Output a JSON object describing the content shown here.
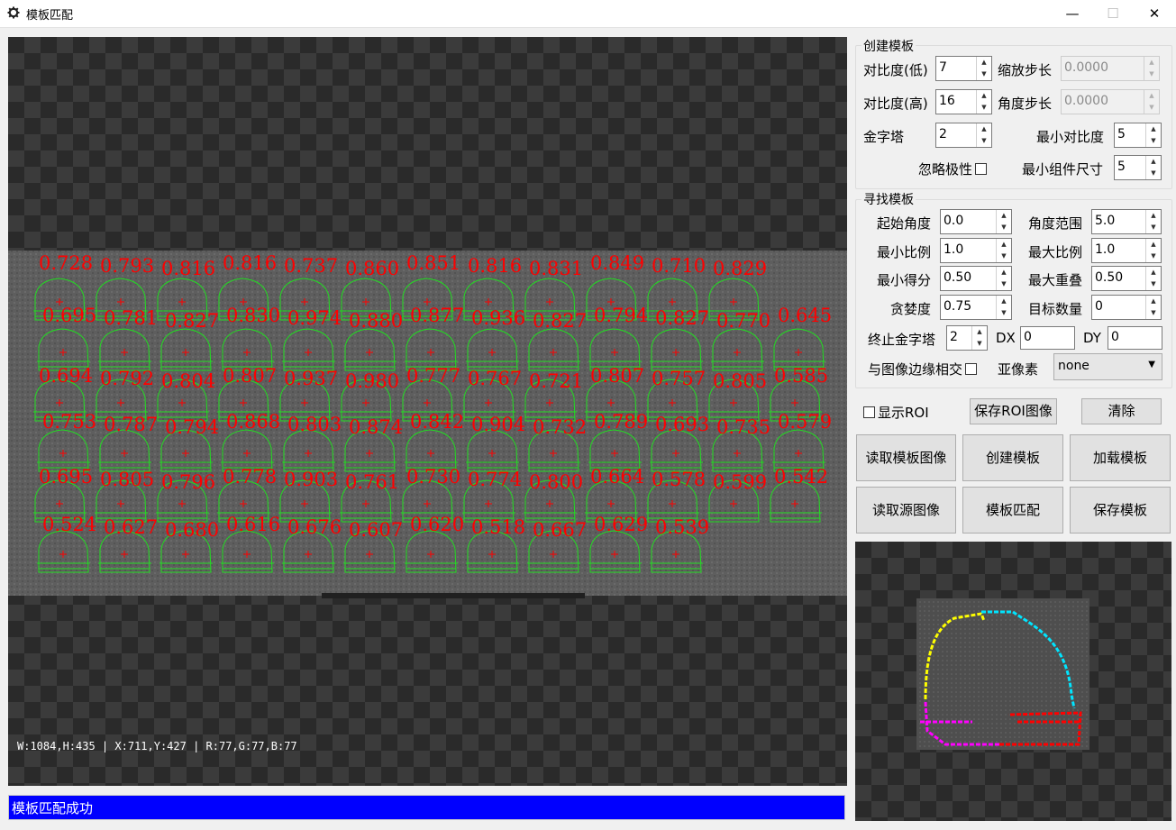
{
  "window": {
    "title": "模板匹配",
    "minimize": "—",
    "maximize": "☐",
    "close": "✕"
  },
  "canvas": {
    "status_text": "W:1084,H:435 | X:711,Y:427 | R:77,G:77,B:77",
    "score_color": "#ff0000",
    "contour_color": "#22dd22",
    "scores": [
      [
        "0.728",
        "0.793",
        "0.816",
        "0.816",
        "0.737",
        "0.860",
        "0.851",
        "0.816",
        "0.831",
        "0.849",
        "0.710",
        "0.829"
      ],
      [
        "0.695",
        "0.781",
        "0.827",
        "0.830",
        "0.974",
        "0.880",
        "0.877",
        "0.936",
        "0.827",
        "0.794",
        "0.827",
        "0.770",
        "0.645"
      ],
      [
        "0.694",
        "0.792",
        "0.804",
        "0.807",
        "0.937",
        "0.980",
        "0.777",
        "0.767",
        "0.721",
        "0.807",
        "0.757",
        "0.805",
        "0.585"
      ],
      [
        "0.753",
        "0.787",
        "0.794",
        "0.868",
        "0.803",
        "0.874",
        "0.842",
        "0.904",
        "0.732",
        "0.789",
        "0.693",
        "0.735",
        "0.579"
      ],
      [
        "0.695",
        "0.805",
        "0.796",
        "0.778",
        "0.903",
        "0.761",
        "0.730",
        "0.774",
        "0.800",
        "0.664",
        "0.578",
        "0.599",
        "0.542"
      ],
      [
        "0.524",
        "0.627",
        "0.680",
        "0.616",
        "0.676",
        "0.607",
        "0.620",
        "0.518",
        "0.667",
        "0.629",
        "0.539"
      ]
    ]
  },
  "message_bar": {
    "text": "模板匹配成功",
    "background": "#0000ff"
  },
  "create_group": {
    "title": "创建模板",
    "contrast_low_label": "对比度(低)",
    "contrast_low": "7",
    "scale_step_label": "缩放步长",
    "scale_step": "0.0000",
    "contrast_high_label": "对比度(高)",
    "contrast_high": "16",
    "angle_step_label": "角度步长",
    "angle_step": "0.0000",
    "pyramid_label": "金字塔",
    "pyramid": "2",
    "min_contrast_label": "最小对比度",
    "min_contrast": "5",
    "ignore_polarity_label": "忽略极性",
    "min_component_label": "最小组件尺寸",
    "min_component": "5"
  },
  "find_group": {
    "title": "寻找模板",
    "start_angle_label": "起始角度",
    "start_angle": "0.0",
    "angle_range_label": "角度范围",
    "angle_range": "5.0",
    "min_scale_label": "最小比例",
    "min_scale": "1.0",
    "max_scale_label": "最大比例",
    "max_scale": "1.0",
    "min_score_label": "最小得分",
    "min_score": "0.50",
    "max_overlap_label": "最大重叠",
    "max_overlap": "0.50",
    "greediness_label": "贪婪度",
    "greediness": "0.75",
    "num_matches_label": "目标数量",
    "num_matches": "0",
    "last_pyramid_label": "终止金字塔",
    "last_pyramid": "2",
    "dx_label": "DX",
    "dx": "0",
    "dy_label": "DY",
    "dy": "0",
    "border_label": "与图像边缘相交",
    "subpixel_label": "亚像素",
    "subpixel": "none"
  },
  "actions": {
    "show_roi": "显示ROI",
    "save_roi": "保存ROI图像",
    "clear": "清除",
    "read_template": "读取模板图像",
    "create_template": "创建模板",
    "load_template": "加载模板",
    "read_source": "读取源图像",
    "match_template": "模板匹配",
    "save_template": "保存模板"
  },
  "preview_colors": {
    "yellow": "#ffff00",
    "cyan": "#00e5ff",
    "magenta": "#ff00ff",
    "red": "#ff0000"
  }
}
